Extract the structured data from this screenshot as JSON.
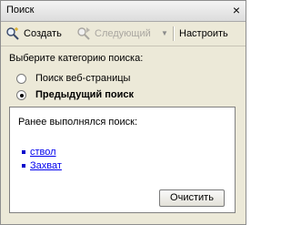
{
  "window": {
    "title": "Поиск",
    "close_glyph": "×"
  },
  "toolbar": {
    "create_label": "Создать",
    "next_label": "Следующий",
    "settings_label": "Настроить"
  },
  "search": {
    "prompt": "Выберите категорию поиска:",
    "options": [
      {
        "label": "Поиск веб-страницы",
        "selected": false
      },
      {
        "label": "Предыдущий поиск",
        "selected": true
      }
    ]
  },
  "history": {
    "caption": "Ранее выполнялся поиск:",
    "items": [
      "ствол",
      "Захват"
    ],
    "clear_label": "Очистить"
  },
  "colors": {
    "link": "#0000ee",
    "disabled_text": "#a9a6a0",
    "panel_bg": "#ece9d8"
  }
}
